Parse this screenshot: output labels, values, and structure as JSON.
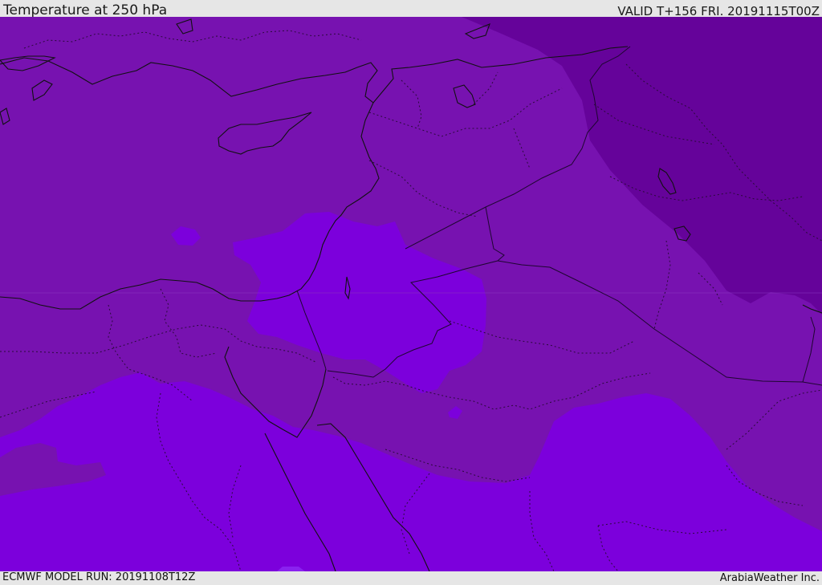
{
  "header": {
    "title": "Temperature at 250 hPa",
    "valid": "VALID T+156 FRI. 20191115T00Z"
  },
  "footer": {
    "model_run": "ECMWF MODEL RUN: 20191108T12Z",
    "credit": "ArabiaWeather Inc."
  },
  "map": {
    "colors": {
      "base": "#7712b0",
      "cold_zone": "#65039a",
      "warm_zone": "#7c00dc",
      "warm_zone_edge": "#8406e8",
      "coastline": "#111111",
      "border": "#2a0a3a"
    }
  }
}
